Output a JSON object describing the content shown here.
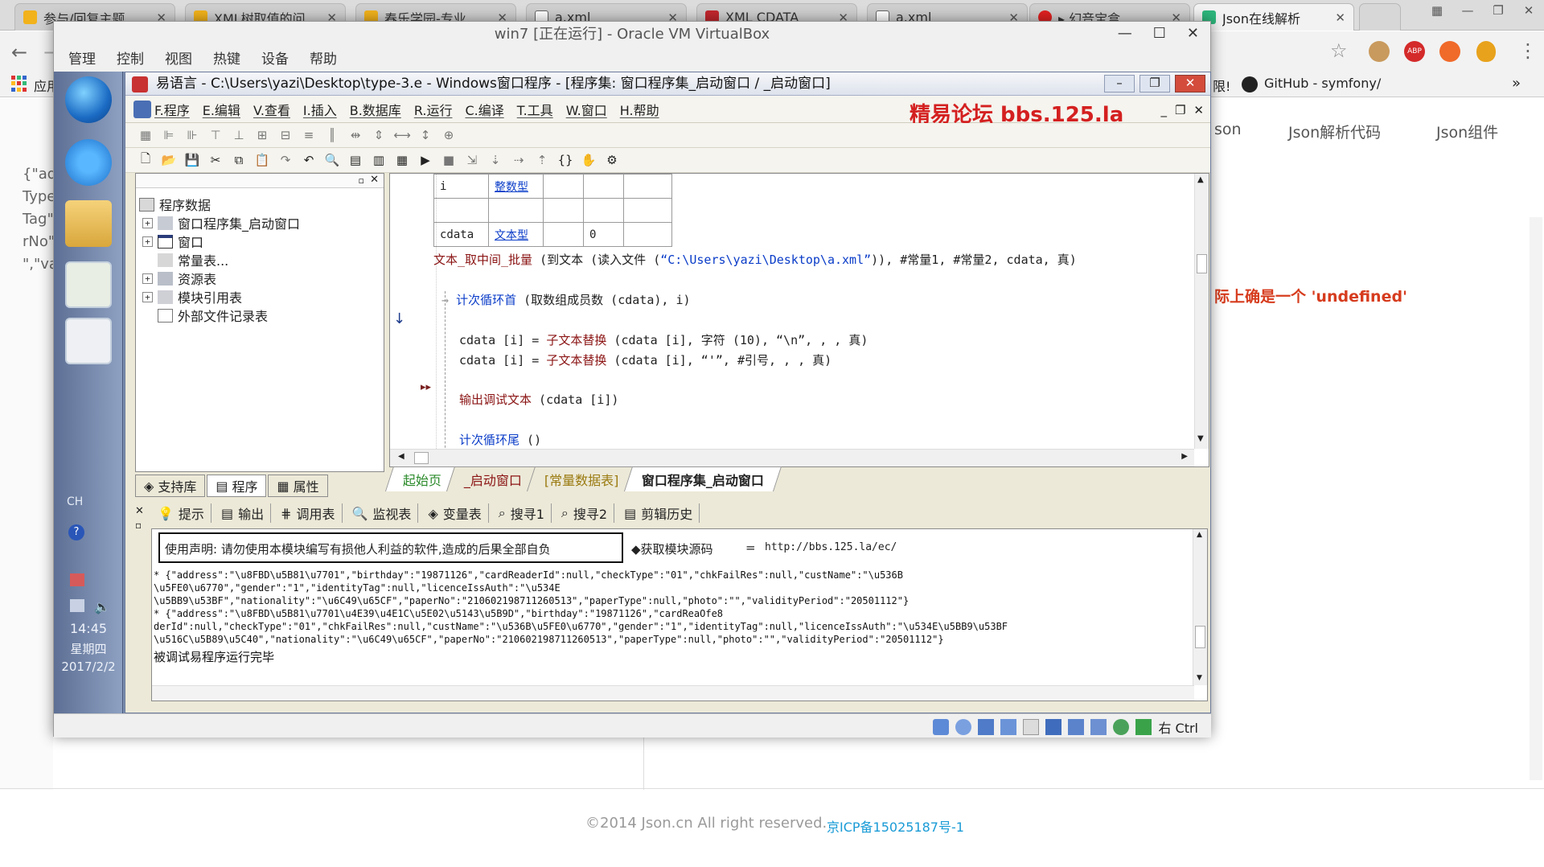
{
  "browser": {
    "tabs": [
      {
        "title": "参与/回复主题",
        "icon_color": "#f2b21b"
      },
      {
        "title": "XML树取值的问",
        "icon_color": "#f2b21b"
      },
      {
        "title": "春乐学园-专业",
        "icon_color": "#f2b21b"
      },
      {
        "title": "a.xml",
        "icon_color": "#666666"
      },
      {
        "title": "XML CDATA",
        "icon_color": "#c1272d"
      },
      {
        "title": "a.xml",
        "icon_color": "#666666"
      },
      {
        "title": "▸ 幻音宝盒",
        "icon_color": "#e02020"
      },
      {
        "title": "Json在线解析",
        "icon_color": "#2db67c"
      }
    ],
    "bookmarks": {
      "apps": "应用",
      "limit": "限!",
      "github": "GitHub - symfony/"
    },
    "more": "»"
  },
  "json_site": {
    "nav": [
      "son",
      "Json解析代码",
      "Json组件"
    ],
    "left_fragments": [
      "{\"ad",
      "Type",
      "Tag\"",
      "rNo\"",
      "\",\"va"
    ],
    "error_text": "际上确是一个 'undefined'",
    "footer": "©2014 Json.cn All right reserved.",
    "icp": "京ICP备15025187号-1"
  },
  "vbox": {
    "title": "win7 [正在运行] - Oracle VM VirtualBox",
    "menu": [
      "管理",
      "控制",
      "视图",
      "热键",
      "设备",
      "帮助"
    ],
    "status_right": "右 Ctrl"
  },
  "guest_taskbar": {
    "lang": "CH",
    "time": "14:45",
    "weekday": "星期四",
    "date": "2017/2/2"
  },
  "eide": {
    "title": "易语言 - C:\\Users\\yazi\\Desktop\\type-3.e - Windows窗口程序 - [程序集: 窗口程序集_启动窗口 / _启动窗口]",
    "menu": [
      "F.程序",
      "E.编辑",
      "V.查看",
      "I.插入",
      "B.数据库",
      "R.运行",
      "C.编译",
      "T.工具",
      "W.窗口",
      "H.帮助"
    ],
    "banner": "精易论坛 bbs.125.la",
    "tree": {
      "root": "程序数据",
      "items": [
        "窗口程序集_启动窗口",
        "窗口",
        "常量表...",
        "资源表",
        "模块引用表",
        "外部文件记录表"
      ]
    },
    "left_tabs": [
      "支持库",
      "程序",
      "属性"
    ],
    "var_table": [
      [
        "i",
        "整数型",
        "",
        "",
        ""
      ],
      [
        "",
        "",
        "",
        "",
        ""
      ],
      [
        "cdata",
        "文本型",
        "",
        "0",
        ""
      ]
    ],
    "code": {
      "line1_cmd": "文本_取中间_批量",
      "line1_rest": " (到文本 (读入文件 (",
      "line1_str": "“C:\\Users\\yazi\\Desktop\\a.xml”",
      "line1_tail": ")), #常量1, #常量2, cdata, 真)",
      "loop_head": "计次循环首",
      "loop_args": " (取数组成员数 (cdata), i)",
      "rep1_pre": "cdata [i] = ",
      "rep1_cmd": "子文本替换",
      "rep1_args": " (cdata [i], 字符 (10), “\\n”, , , 真)",
      "rep2_pre": "cdata [i] = ",
      "rep2_cmd": "子文本替换",
      "rep2_args": " (cdata [i], “'”, #引号, , , 真)",
      "debug_cmd": "输出调试文本",
      "debug_args": " (cdata [i])",
      "loop_tail": "计次循环尾",
      "loop_tail_args": " ()"
    },
    "code_tabs": [
      "起始页",
      "_启动窗口",
      "[常量数据表]",
      "窗口程序集_启动窗口"
    ],
    "bottom_tabs": [
      "提示",
      "输出",
      "调用表",
      "监视表",
      "变量表",
      "搜寻1",
      "搜寻2",
      "剪辑历史"
    ],
    "output": {
      "notice": "使用声明: 请勿使用本模块编写有损他人利益的软件,造成的后果全部自负",
      "src_label": "◆获取模块源码",
      "src_eq": "=",
      "src_url": "http://bbs.125.la/ec/",
      "lines": [
        "* {\"address\":\"\\u8FBD\\u5B81\\u7701\",\"birthday\":\"19871126\",\"cardReaderId\":null,\"checkType\":\"01\",\"chkFailRes\":null,\"custName\":\"\\u536B",
        "\\u5FE0\\u6770\",\"gender\":\"1\",\"identityTag\":null,\"licenceIssAuth\":\"\\u534E",
        "\\u5BB9\\u53BF\",\"nationality\":\"\\u6C49\\u65CF\",\"paperNo\":\"210602198711260513\",\"paperType\":null,\"photo\":\"\",\"validityPeriod\":\"20501112\"}",
        "* {\"address\":\"\\u8FBD\\u5B81\\u7701\\u4E39\\u4E1C\\u5E02\\u5143\\u5B9D\",\"birthday\":\"19871126\",\"cardReaOfe8",
        "derId\":null,\"checkType\":\"01\",\"chkFailRes\":null,\"custName\":\"\\u536B\\u5FE0\\u6770\",\"gender\":\"1\",\"identityTag\":null,\"licenceIssAuth\":\"\\u534E\\u5BB9\\u53BF",
        "\\u516C\\u5B89\\u5C40\",\"nationality\":\"\\u6C49\\u65CF\",\"paperNo\":\"210602198711260513\",\"paperType\":null,\"photo\":\"\",\"validityPeriod\":\"20501112\"}",
        "被调试易程序运行完毕"
      ]
    }
  }
}
